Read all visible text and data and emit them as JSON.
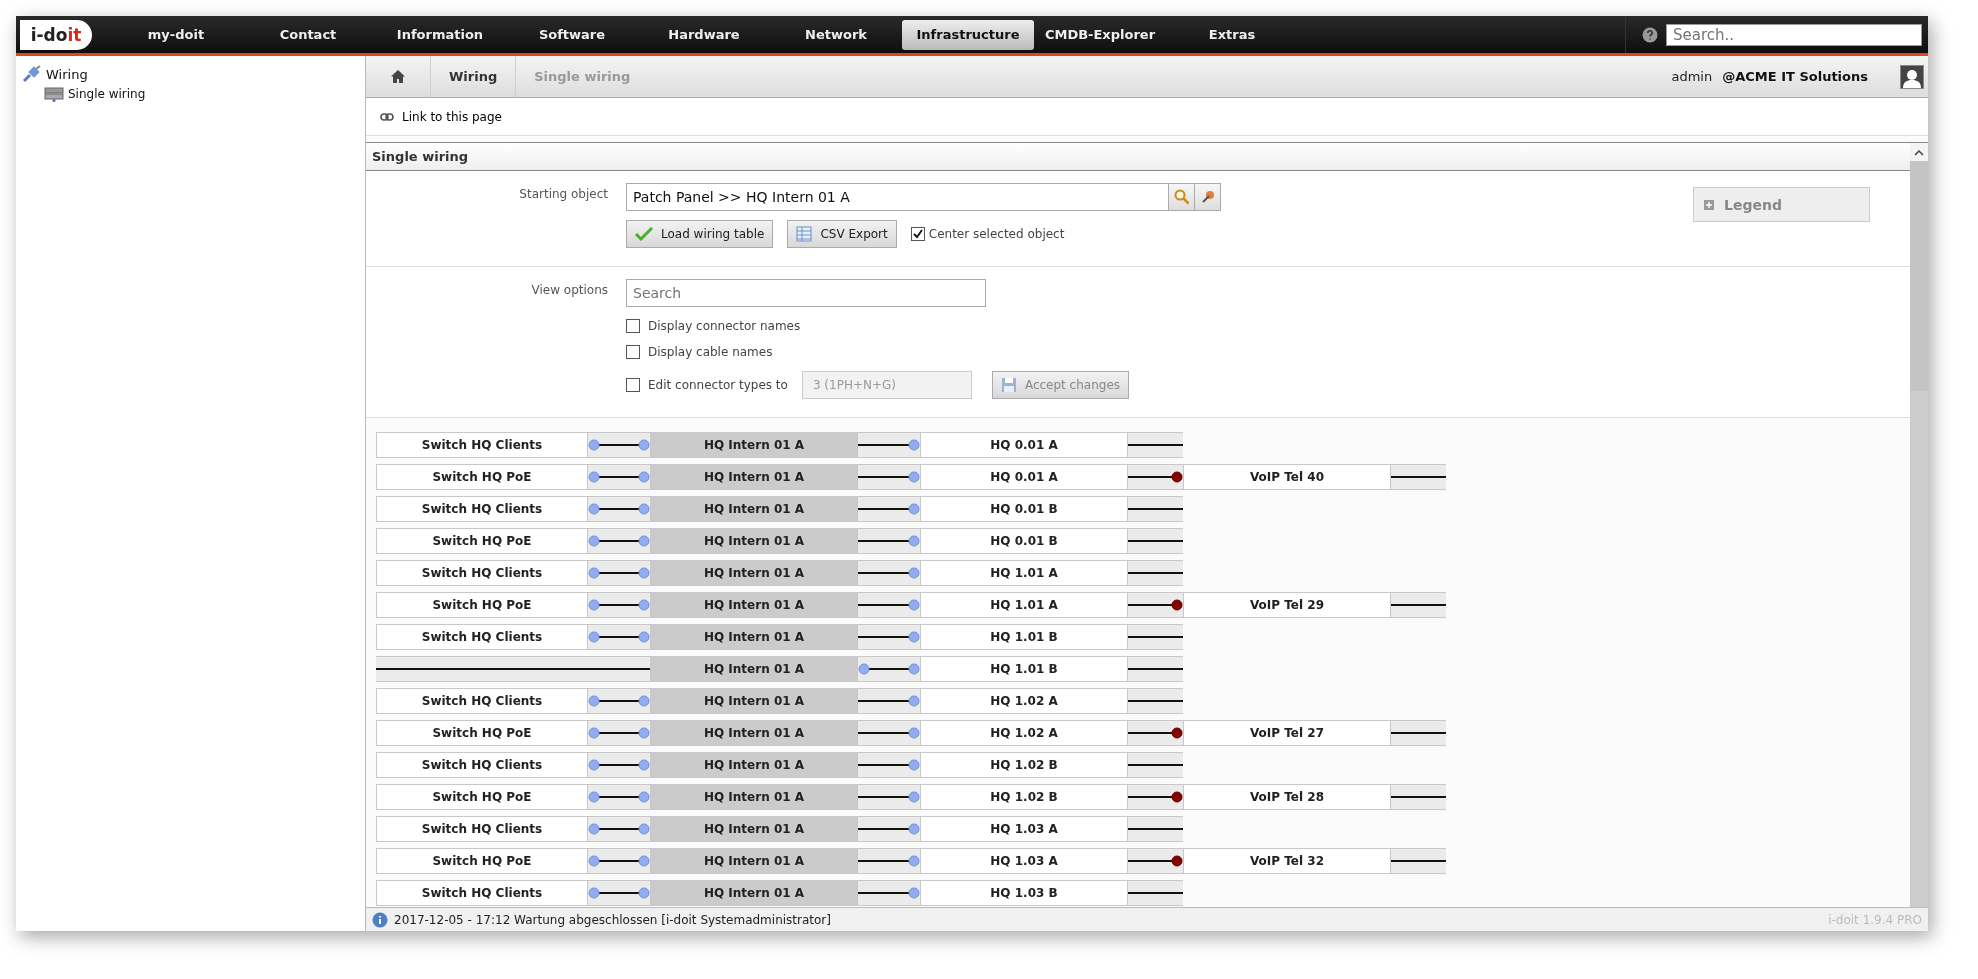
{
  "nav": {
    "logo": {
      "main": "i-do",
      "accent": "it"
    },
    "items": [
      {
        "label": "my-doit",
        "selected": false
      },
      {
        "label": "Contact",
        "selected": false
      },
      {
        "label": "Information",
        "selected": false
      },
      {
        "label": "Software",
        "selected": false
      },
      {
        "label": "Hardware",
        "selected": false
      },
      {
        "label": "Network",
        "selected": false
      },
      {
        "label": "Infrastructure",
        "selected": true
      },
      {
        "label": "CMDB-Explorer",
        "selected": false
      },
      {
        "label": "Extras",
        "selected": false
      }
    ],
    "search": {
      "placeholder": "Search.."
    }
  },
  "sidebar": {
    "tree": [
      {
        "label": "Wiring",
        "children": [
          {
            "label": "Single wiring"
          }
        ]
      }
    ]
  },
  "breadcrumb": [
    "Wiring",
    "Single wiring"
  ],
  "user": {
    "name": "admin",
    "tenant": "@ACME IT Solutions"
  },
  "link": "Link to this page",
  "section": {
    "title": "Single wiring"
  },
  "starting_object": {
    "label": "Starting object",
    "value": "Patch Panel >> HQ Intern 01 A"
  },
  "actions": [
    {
      "label": "Load wiring table",
      "kind": "check"
    },
    {
      "label": "CSV Export",
      "kind": "table"
    }
  ],
  "center_selected": {
    "label": "Center selected object",
    "checked": true
  },
  "legend": "Legend",
  "view_options": {
    "label": "View options",
    "search": {
      "placeholder": "Search"
    },
    "options": [
      {
        "label": "Display connector names",
        "checked": false
      },
      {
        "label": "Display cable names",
        "checked": false
      },
      {
        "label": "Edit connector types to",
        "checked": false
      }
    ],
    "connector_type": {
      "value": "3 (1PH+N+G)",
      "disabled": true
    },
    "accept": {
      "label": "Accept changes",
      "disabled": true
    }
  },
  "wiring": {
    "rows": [
      {
        "source": "Switch HQ Clients",
        "panel": "HQ Intern 01 A",
        "outlet": "HQ 0.01 A"
      },
      {
        "source": "Switch HQ PoE",
        "panel": "HQ Intern 01 A",
        "outlet": "HQ 0.01 A",
        "device": "VoIP Tel 40"
      },
      {
        "source": "Switch HQ Clients",
        "panel": "HQ Intern 01 A",
        "outlet": "HQ 0.01 B"
      },
      {
        "source": "Switch HQ PoE",
        "panel": "HQ Intern 01 A",
        "outlet": "HQ 0.01 B"
      },
      {
        "source": "Switch HQ Clients",
        "panel": "HQ Intern 01 A",
        "outlet": "HQ 1.01 A"
      },
      {
        "source": "Switch HQ PoE",
        "panel": "HQ Intern 01 A",
        "outlet": "HQ 1.01 A",
        "device": "VoIP Tel 29"
      },
      {
        "source": "Switch HQ Clients",
        "panel": "HQ Intern 01 A",
        "outlet": "HQ 1.01 B"
      },
      {
        "panel": "HQ Intern 01 A",
        "outlet": "HQ 1.01 B"
      },
      {
        "source": "Switch HQ Clients",
        "panel": "HQ Intern 01 A",
        "outlet": "HQ 1.02 A"
      },
      {
        "source": "Switch HQ PoE",
        "panel": "HQ Intern 01 A",
        "outlet": "HQ 1.02 A",
        "device": "VoIP Tel 27"
      },
      {
        "source": "Switch HQ Clients",
        "panel": "HQ Intern 01 A",
        "outlet": "HQ 1.02 B"
      },
      {
        "source": "Switch HQ PoE",
        "panel": "HQ Intern 01 A",
        "outlet": "HQ 1.02 B",
        "device": "VoIP Tel 28"
      },
      {
        "source": "Switch HQ Clients",
        "panel": "HQ Intern 01 A",
        "outlet": "HQ 1.03 A"
      },
      {
        "source": "Switch HQ PoE",
        "panel": "HQ Intern 01 A",
        "outlet": "HQ 1.03 A",
        "device": "VoIP Tel 32"
      },
      {
        "source": "Switch HQ Clients",
        "panel": "HQ Intern 01 A",
        "outlet": "HQ 1.03 B"
      }
    ]
  },
  "status_bar": {
    "message": "2017-12-05 - 17:12 Wartung abgeschlossen [i-doit Systemadministrator]",
    "version": "i-doit 1.9.4 PRO"
  }
}
